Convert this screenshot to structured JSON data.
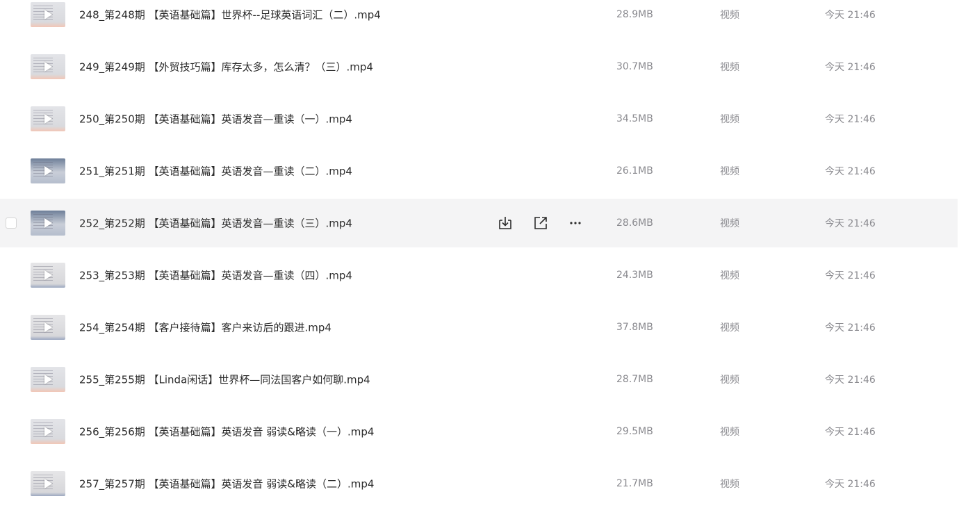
{
  "files": [
    {
      "name": "248_第248期 【英语基础篇】世界杯--足球英语词汇（二）.mp4",
      "size": "28.9MB",
      "type": "视频",
      "modified": "今天 21:46",
      "thumbnail": "video-thumbnail"
    },
    {
      "name": "249_第249期 【外贸技巧篇】库存太多，怎么清？（三）.mp4",
      "size": "30.7MB",
      "type": "视频",
      "modified": "今天 21:46",
      "thumbnail": "video-thumbnail"
    },
    {
      "name": "250_第250期 【英语基础篇】英语发音—重读（一）.mp4",
      "size": "34.5MB",
      "type": "视频",
      "modified": "今天 21:46",
      "thumbnail": "video-thumbnail"
    },
    {
      "name": "251_第251期 【英语基础篇】英语发音—重读（二）.mp4",
      "size": "26.1MB",
      "type": "视频",
      "modified": "今天 21:46",
      "thumbnail": "video-thumbnail"
    },
    {
      "name": "252_第252期 【英语基础篇】英语发音—重读（三）.mp4",
      "size": "28.6MB",
      "type": "视频",
      "modified": "今天 21:46",
      "thumbnail": "video-thumbnail",
      "hovered": true
    },
    {
      "name": "253_第253期 【英语基础篇】英语发音—重读（四）.mp4",
      "size": "24.3MB",
      "type": "视频",
      "modified": "今天 21:46",
      "thumbnail": "video-thumbnail"
    },
    {
      "name": "254_第254期 【客户接待篇】客户来访后的跟进.mp4",
      "size": "37.8MB",
      "type": "视频",
      "modified": "今天 21:46",
      "thumbnail": "video-thumbnail"
    },
    {
      "name": "255_第255期 【Linda闲话】世界杯—同法国客户如何聊.mp4",
      "size": "28.7MB",
      "type": "视频",
      "modified": "今天 21:46",
      "thumbnail": "video-thumbnail"
    },
    {
      "name": "256_第256期 【英语基础篇】英语发音 弱读&略读（一）.mp4",
      "size": "29.5MB",
      "type": "视频",
      "modified": "今天 21:46",
      "thumbnail": "video-thumbnail"
    },
    {
      "name": "257_第257期 【英语基础篇】英语发音 弱读&略读（二）.mp4",
      "size": "21.7MB",
      "type": "视频",
      "modified": "今天 21:46",
      "thumbnail": "video-thumbnail"
    }
  ],
  "row_actions": {
    "download_icon": "download-icon",
    "share_icon": "share-icon",
    "more_icon": "more-icon"
  },
  "colors": {
    "hover_bg": "#f4f4f5",
    "name_text": "#2b2b2b",
    "meta_text": "#8a8a8f",
    "icon": "#2b2b2b"
  }
}
